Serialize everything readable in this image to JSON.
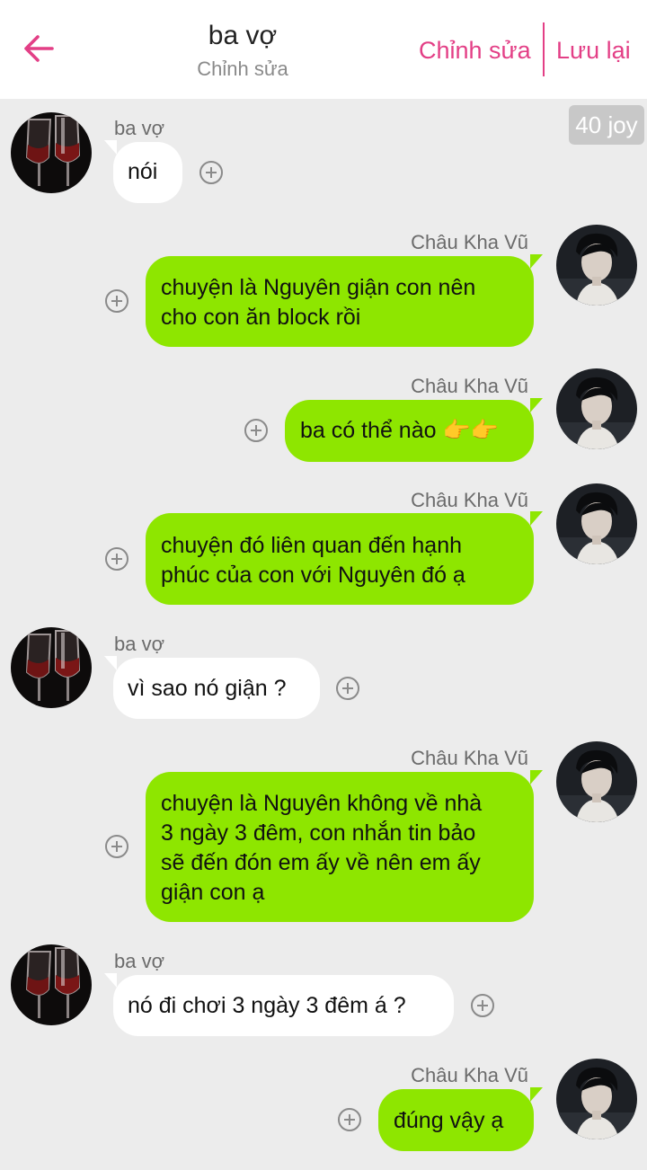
{
  "header": {
    "title": "ba vợ",
    "subtitle": "Chỉnh sửa",
    "edit_label": "Chỉnh sửa",
    "save_label": "Lưu lại",
    "accent_color": "#e33f86"
  },
  "badge": {
    "label": "40 joy"
  },
  "colors": {
    "left_bubble": "#ffffff",
    "right_bubble": "#8ee600",
    "background": "#ececec"
  },
  "messages": [
    {
      "side": "left",
      "sender": "ba vợ",
      "text": "nói"
    },
    {
      "side": "right",
      "sender": "Châu Kha Vũ",
      "text": "chuyện là Nguyên giận con nên\ncho con ăn block rồi"
    },
    {
      "side": "right",
      "sender": "Châu Kha Vũ",
      "text": "ba có thể nào 👉👉"
    },
    {
      "side": "right",
      "sender": "Châu Kha Vũ",
      "text": "chuyện đó liên quan đến hạnh\nphúc của con với Nguyên đó ạ"
    },
    {
      "side": "left",
      "sender": "ba vợ",
      "text": "vì sao nó giận ?"
    },
    {
      "side": "right",
      "sender": "Châu Kha Vũ",
      "text": "chuyện là Nguyên không về nhà\n3 ngày 3 đêm, con nhắn tin bảo\nsẽ đến đón em ấy về nên em ấy\ngiận con ạ"
    },
    {
      "side": "left",
      "sender": "ba vợ",
      "text": "nó đi chơi 3 ngày 3 đêm á ?"
    },
    {
      "side": "right",
      "sender": "Châu Kha Vũ",
      "text": "đúng vậy ạ"
    }
  ]
}
